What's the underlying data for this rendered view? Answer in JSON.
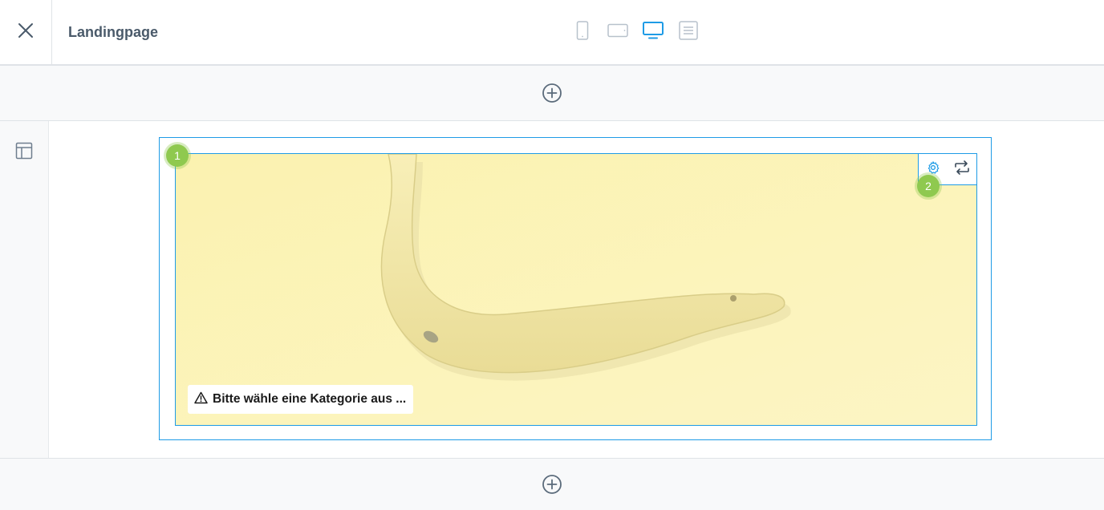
{
  "header": {
    "title": "Landingpage",
    "close_icon": "close-icon",
    "viewports": [
      {
        "name": "mobile",
        "icon": "smartphone-icon",
        "active": false
      },
      {
        "name": "tablet",
        "icon": "tablet-icon",
        "active": false
      },
      {
        "name": "desktop",
        "icon": "desktop-icon",
        "active": true
      },
      {
        "name": "list",
        "icon": "document-list-icon",
        "active": false
      }
    ],
    "accent_color": "#1e9be6"
  },
  "sidebar": {
    "items": [
      {
        "icon": "layout-icon"
      }
    ]
  },
  "canvas": {
    "add_top_icon": "plus-circle-icon",
    "add_bottom_icon": "plus-circle-icon",
    "block": {
      "image_subject": "banana on yellow background",
      "warning_icon": "warning-triangle-icon",
      "warning_text": "Bitte wähle eine Kategorie aus ...",
      "toolbar": {
        "settings_icon": "gear-icon",
        "swap_icon": "swap-icon"
      }
    },
    "badges": [
      {
        "label": "1"
      },
      {
        "label": "2"
      }
    ],
    "badge_color": "#8fc94f"
  }
}
